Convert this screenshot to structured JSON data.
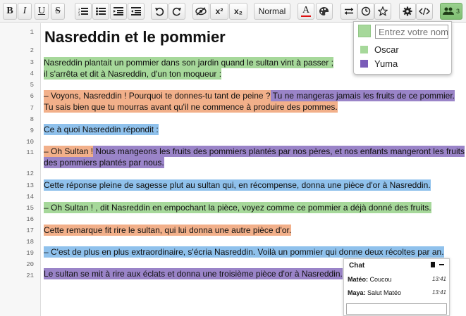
{
  "toolbar": {
    "bold": "B",
    "italic": "I",
    "underline": "U",
    "strike": "S",
    "superscript": "x²",
    "subscript": "x₂",
    "heading_select": "Normal",
    "font_color": "A",
    "user_count": "3",
    "icons": [
      "ordered-list",
      "unordered-list",
      "indent",
      "outdent",
      "undo",
      "redo",
      "hide-authorship",
      "superscript",
      "subscript",
      "font-color",
      "palette",
      "import-export",
      "timeslider",
      "star",
      "settings",
      "embed",
      "users"
    ]
  },
  "document": {
    "title": "Nasreddin et le pommier",
    "line_numbers": [
      "1",
      "2",
      "3",
      "4",
      "5",
      "6",
      "7",
      "8",
      "9",
      "10",
      "11",
      "12",
      "13",
      "14",
      "15",
      "16",
      "17",
      "18",
      "19",
      "20",
      "21"
    ],
    "lines": [
      {
        "n": 3,
        "segments": [
          {
            "text": "Nasreddin plantait un pommier dans son jardin quand le sultan vint à passer ;",
            "author": "green"
          }
        ]
      },
      {
        "n": 4,
        "segments": [
          {
            "text": " il s'arrêta et dit à Nasreddin, d'un ton moqueur :",
            "author": "green"
          }
        ]
      },
      {
        "n": 6,
        "segments": [
          {
            "text": "– Voyons, Nasreddin ! Pourquoi te donnes-tu tant de peine ?",
            "author": "orange"
          },
          {
            "text": " Tu ne mangeras jamais les fruits de ce pommier.",
            "author": "purple"
          }
        ]
      },
      {
        "n": 7,
        "segments": [
          {
            "text": "Tu sais bien que tu mourras avant qu'il ne commence à produire des pommes.",
            "author": "orange"
          }
        ]
      },
      {
        "n": 9,
        "segments": [
          {
            "text": "Ce à quoi Nasreddin répondit :",
            "author": "blue"
          }
        ]
      },
      {
        "n": 11,
        "segments": [
          {
            "text": "– Oh Sultan !",
            "author": "orange"
          },
          {
            "text": " Nous mangeons les fruits des pommiers plantés par nos pères, et nos enfants mangeront les fruits",
            "author": "purple"
          }
        ]
      },
      {
        "n": 11.5,
        "segments": [
          {
            "text": "des pommiers plantés par nous.",
            "author": "purple"
          }
        ]
      },
      {
        "n": 13,
        "segments": [
          {
            "text": "Cette réponse pleine de sagesse plut au sultan qui, en récompense, donna une pièce d'or à Nasreddin.",
            "author": "blue"
          }
        ]
      },
      {
        "n": 15,
        "segments": [
          {
            "text": "– Oh Sultan ! , dit Nasreddin en empochant la pièce, voyez comme ce pommier a déjà donné des fruits.",
            "author": "green"
          }
        ]
      },
      {
        "n": 17,
        "segments": [
          {
            "text": "Cette remarque fit rire le sultan, qui lui donna une autre pièce d'or.",
            "author": "orange"
          }
        ]
      },
      {
        "n": 19,
        "segments": [
          {
            "text": "– C'est de plus en plus extraordinaire, s'écria Nasreddin. Voilà un pommier qui donne deux récoltes par an.",
            "author": "blue"
          }
        ]
      },
      {
        "n": 21,
        "segments": [
          {
            "text": "Le sultan se mit à rire aux éclats et donna une troisième pièce d'or à Nasreddin.",
            "author": "purple"
          }
        ]
      }
    ]
  },
  "users_popup": {
    "name_placeholder": "Entrez votre nom",
    "users": [
      {
        "name": "Oscar",
        "color": "#a6d89a"
      },
      {
        "name": "Yuma",
        "color": "#7a5cb8"
      }
    ]
  },
  "chat": {
    "title": "Chat",
    "messages": [
      {
        "author": "Matéo:",
        "text": "Coucou",
        "time": "13:41"
      },
      {
        "author": "Maya:",
        "text": "Salut Matéo",
        "time": "13:41"
      }
    ]
  },
  "colors": {
    "green": "#a6d89a",
    "orange": "#f2b08a",
    "purple": "#9a84c8",
    "blue": "#8fc1ec"
  }
}
